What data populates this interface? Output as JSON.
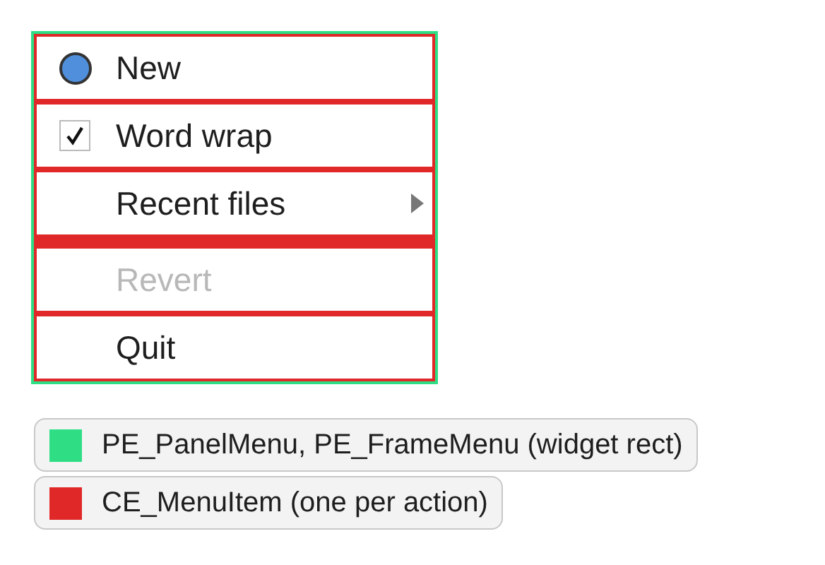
{
  "menu": {
    "items": [
      {
        "kind": "radio",
        "label": "New",
        "checked": true,
        "disabled": false
      },
      {
        "kind": "check",
        "label": "Word wrap",
        "checked": true,
        "disabled": false
      },
      {
        "kind": "submenu",
        "label": "Recent files",
        "disabled": false
      },
      {
        "kind": "separator"
      },
      {
        "kind": "plain",
        "label": "Revert",
        "disabled": true
      },
      {
        "kind": "plain",
        "label": "Quit",
        "disabled": false
      }
    ]
  },
  "legend": [
    {
      "label": "PE_PanelMenu, PE_FrameMenu (widget rect)",
      "color": "#2fde84"
    },
    {
      "label": "CE_MenuItem (one per action)",
      "color": "#e02828"
    }
  ]
}
